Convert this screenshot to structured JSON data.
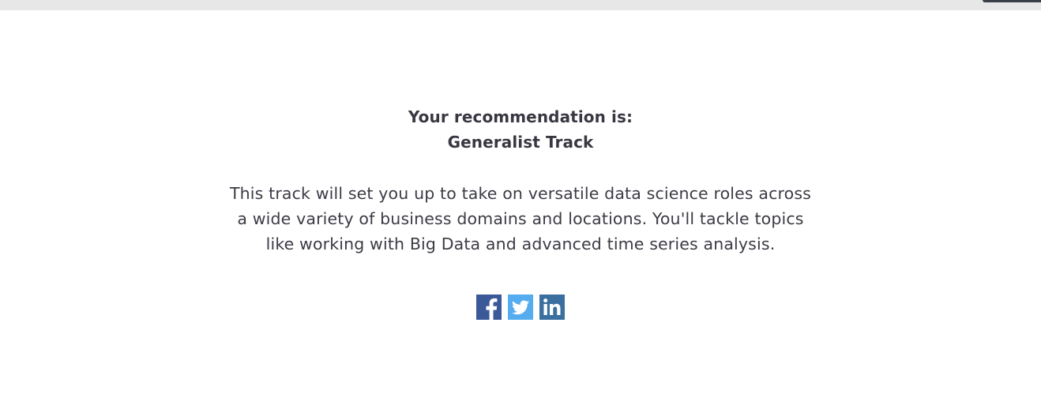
{
  "recommendation": {
    "intro": "Your recommendation is:",
    "track": "Generalist Track",
    "description": "This track will set you up to take on versatile data science roles across a wide variety of business domains and locations. You'll tackle topics like working with Big Data and advanced time series analysis."
  },
  "share": {
    "items": [
      {
        "icon": "facebook-icon",
        "color": "#3b5998"
      },
      {
        "icon": "twitter-icon",
        "color": "#55acee"
      },
      {
        "icon": "linkedin-icon",
        "color": "#3a6f9f"
      }
    ]
  },
  "colors": {
    "text": "#3d3a44",
    "top_bar": "#e7e7e7"
  }
}
